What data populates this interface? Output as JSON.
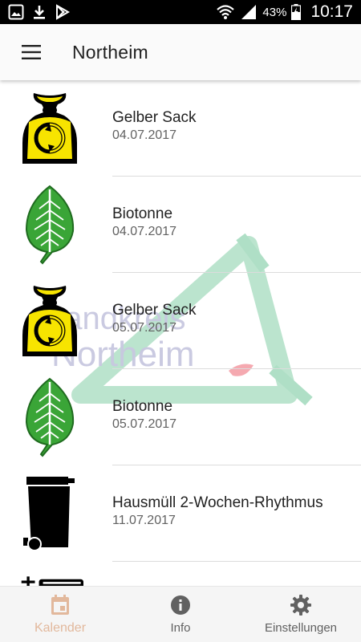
{
  "status_bar": {
    "battery": "43%",
    "time": "10:17",
    "left_icons": [
      "gallery-icon",
      "download-icon",
      "play-store-icon"
    ],
    "right_icons": [
      "wifi-icon",
      "signal-icon",
      "battery-charging-icon"
    ]
  },
  "app_bar": {
    "title": "Northeim",
    "menu_icon": "hamburger-menu-icon"
  },
  "watermark": {
    "line1": "Landkreis",
    "line2": "Northeim"
  },
  "items": [
    {
      "type": "gelber-sack",
      "title": "Gelber Sack",
      "date": "04.07.2017"
    },
    {
      "type": "biotonne",
      "title": "Biotonne",
      "date": "04.07.2017"
    },
    {
      "type": "gelber-sack",
      "title": "Gelber Sack",
      "date": "05.07.2017"
    },
    {
      "type": "biotonne",
      "title": "Biotonne",
      "date": "05.07.2017"
    },
    {
      "type": "hausmuell",
      "title": "Hausmüll 2-Wochen-Rhythmus",
      "date": "11.07.2017"
    }
  ],
  "bottom_nav": [
    {
      "label": "Kalender",
      "icon": "calendar-icon",
      "active": true
    },
    {
      "label": "Info",
      "icon": "info-icon",
      "active": false
    },
    {
      "label": "Einstellungen",
      "icon": "gear-icon",
      "active": false
    }
  ],
  "colors": {
    "accent": "#e2b89c",
    "yellow_bag": "#f7e400",
    "leaf_green": "#3aa537",
    "watermark_green": "#a7dcc0",
    "watermark_text": "#c8c8e0"
  }
}
